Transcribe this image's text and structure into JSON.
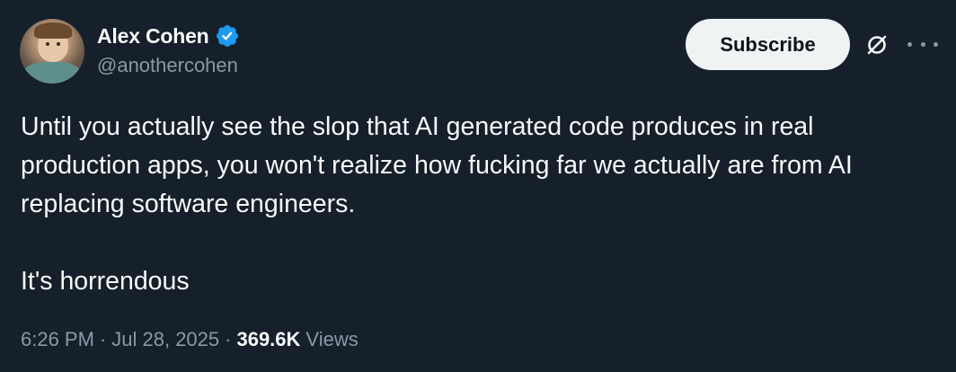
{
  "author": {
    "display_name": "Alex Cohen",
    "handle": "@anothercohen",
    "verified": true,
    "avatar_icon": "avatar-photo"
  },
  "actions": {
    "subscribe_label": "Subscribe",
    "grok_icon": "grok-icon",
    "more_icon": "more-icon"
  },
  "tweet": {
    "paragraphs": [
      "Until you actually see the slop that AI generated code produces in real production apps, you won't realize how fucking far we actually are from AI replacing software engineers.",
      "It's horrendous"
    ]
  },
  "meta": {
    "time": "6:26 PM",
    "separator": "·",
    "date": "Jul 28, 2025",
    "views_count": "369.6K",
    "views_label": "Views"
  },
  "colors": {
    "background": "#15202b",
    "text_primary": "#f7f9f9",
    "text_secondary": "#8b98a5",
    "verified_badge": "#1d9bf0",
    "subscribe_bg": "#eff3f4"
  }
}
